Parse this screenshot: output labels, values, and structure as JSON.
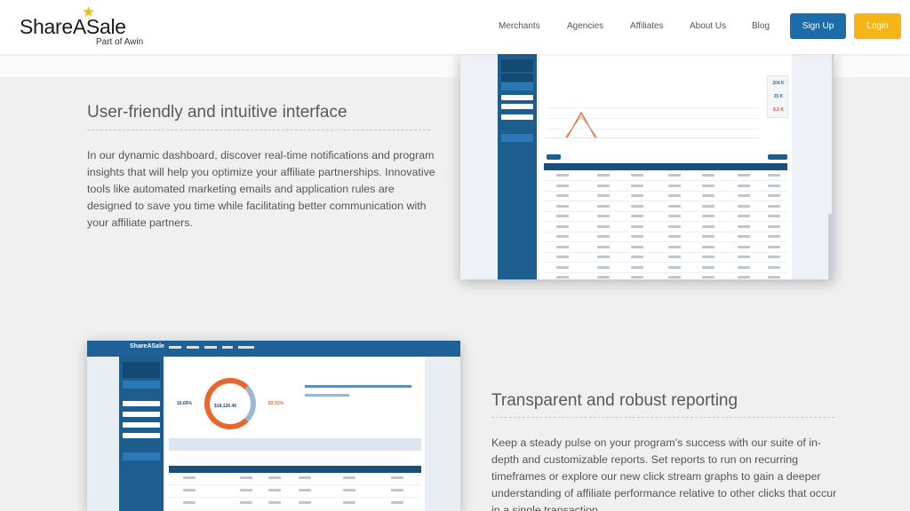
{
  "header": {
    "logo_text": "ShareASale",
    "logo_sub": "Part of Awin",
    "nav": [
      "Merchants",
      "Agencies",
      "Affiliates",
      "About Us",
      "Blog"
    ],
    "signup_label": "Sign Up",
    "login_label": "Login",
    "signup_color": "#1b6ca8",
    "login_color": "#f5b417"
  },
  "section1": {
    "title": "User-friendly and intuitive interface",
    "body": "In our dynamic dashboard, discover real-time notifications and program insights that will help you optimize your affiliate partnerships. Innovative tools like automated marketing emails and application rules are designed to save you time while facilitating better communication with your affiliate partners."
  },
  "section2": {
    "title": "Transparent and robust reporting",
    "body": "Keep a steady pulse on your program’s success with our suite of in-depth and customizable reports. Set reports to run on recurring timeframes or explore our new click stream graphs to gain a deeper understanding of affiliate performance relative to other clicks that occur in a single transaction."
  },
  "dashboard1": {
    "kpis": [
      "204 K",
      "25 K",
      "8.2 K"
    ],
    "kpi_colors": [
      "#2a6fb0",
      "#2a6fb0",
      "#d9534f"
    ]
  },
  "dashboard2": {
    "brand": "ShareASale",
    "left_pct": "16.69%",
    "center_value": "$18,126.46",
    "right_pct": "83.31%",
    "accent": "#e8662e"
  }
}
